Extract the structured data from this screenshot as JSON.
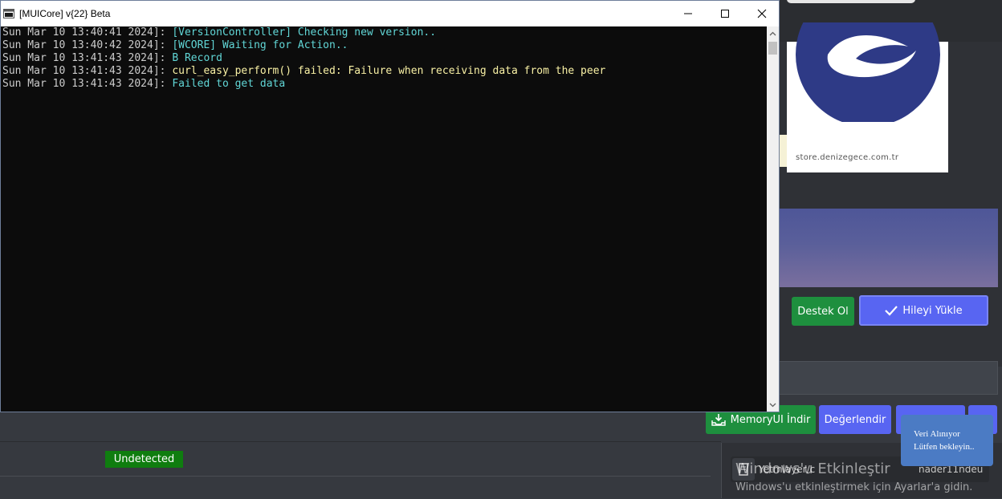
{
  "console": {
    "title": "[MUICore] v{22} Beta",
    "lines": [
      {
        "timestamp": "Sun Mar 10 13:40:41 2024]: ",
        "message": "[VersionController] Checking new version..",
        "color": "#61d6d6"
      },
      {
        "timestamp": "Sun Mar 10 13:40:42 2024]: ",
        "message": "[WCORE] Waiting for Action..",
        "color": "#61d6d6"
      },
      {
        "timestamp": "Sun Mar 10 13:41:43 2024]: ",
        "message": "B Record",
        "color": "#61d6d6"
      },
      {
        "timestamp": "Sun Mar 10 13:41:43 2024]: ",
        "message": "curl_easy_perform() failed: Failure when receiving data from the peer",
        "color": "#f9f1a5"
      },
      {
        "timestamp": "Sun Mar 10 13:41:43 2024]: ",
        "message": "Failed to get data",
        "color": "#61d6d6"
      }
    ]
  },
  "promo": {
    "url": "store.denizegece.com.tr"
  },
  "buttons": {
    "destek": "Destek Ol",
    "hileyi_yukle": "Hileyi Yükle",
    "memoryui_indir": "MemoryUI İndir",
    "degerlendir": "Değerlendir"
  },
  "status": {
    "undetected": "Undetected"
  },
  "user": {
    "label": "Yetmlayer/c",
    "name": "nader11ndeu"
  },
  "toast": {
    "line1": "Veri Alınıyor",
    "line2": "Lütfen bekleyin.."
  },
  "watermark": {
    "title": "Windows'u Etkinleştir",
    "subtitle": "Windows'u etkinleştirmek için Ayarlar'a gidin."
  },
  "colors": {
    "accent": "#5865f2",
    "success": "#1e8f3e",
    "undetected": "#0f7d0f"
  }
}
